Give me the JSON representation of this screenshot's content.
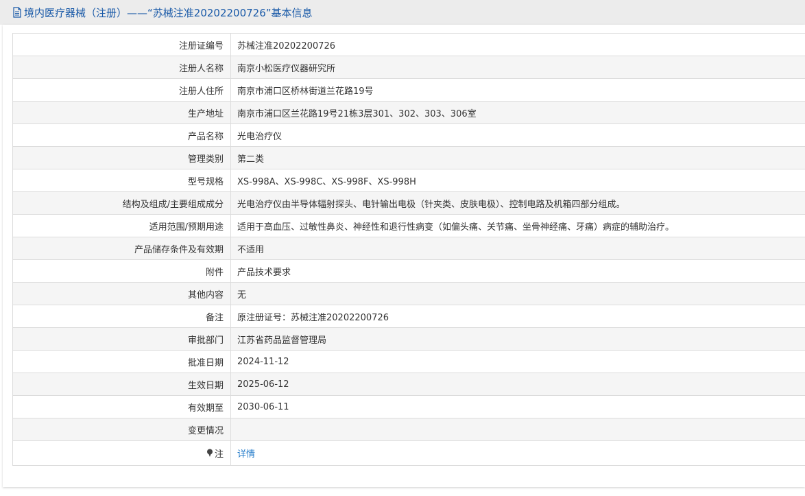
{
  "header": {
    "title": "境内医疗器械（注册）——“苏械注准20202200726”基本信息",
    "accent_color": "#1a5aa8",
    "icon": "document-icon"
  },
  "rows": [
    {
      "label": "注册证编号",
      "value": "苏械注准20202200726"
    },
    {
      "label": "注册人名称",
      "value": "南京小松医疗仪器研究所"
    },
    {
      "label": "注册人住所",
      "value": "南京市浦口区桥林街道兰花路19号"
    },
    {
      "label": "生产地址",
      "value": "南京市浦口区兰花路19号21栋3层301、302、303、306室"
    },
    {
      "label": "产品名称",
      "value": "光电治疗仪"
    },
    {
      "label": "管理类别",
      "value": "第二类"
    },
    {
      "label": "型号规格",
      "value": "XS-998A、XS-998C、XS-998F、XS-998H"
    },
    {
      "label": "结构及组成/主要组成成分",
      "value": "光电治疗仪由半导体辐射探头、电针输出电极（针夹类、皮肤电极）、控制电路及机箱四部分组成。"
    },
    {
      "label": "适用范围/预期用途",
      "value": "适用于高血压、过敏性鼻炎、神经性和退行性病变（如偏头痛、关节痛、坐骨神经痛、牙痛）病症的辅助治疗。"
    },
    {
      "label": "产品储存条件及有效期",
      "value": "不适用"
    },
    {
      "label": "附件",
      "value": "产品技术要求"
    },
    {
      "label": "其他内容",
      "value": "无"
    },
    {
      "label": "备注",
      "value": "原注册证号：苏械注准20202200726"
    },
    {
      "label": "审批部门",
      "value": "江苏省药品监督管理局"
    },
    {
      "label": "批准日期",
      "value": "2024-11-12"
    },
    {
      "label": "生效日期",
      "value": "2025-06-12"
    },
    {
      "label": "有效期至",
      "value": "2030-06-11"
    },
    {
      "label": "变更情况",
      "value": ""
    }
  ],
  "note": {
    "label": "注",
    "icon": "pin-icon",
    "link_text": "详情",
    "link_color": "#1e78c8"
  }
}
